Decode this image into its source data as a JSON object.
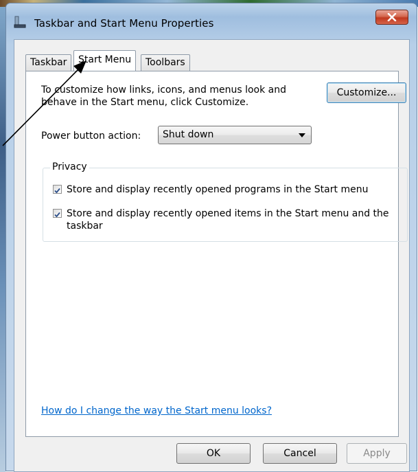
{
  "window": {
    "title": "Taskbar and Start Menu Properties"
  },
  "tabs": [
    {
      "label": "Taskbar",
      "active": false
    },
    {
      "label": "Start Menu",
      "active": true
    },
    {
      "label": "Toolbars",
      "active": false
    }
  ],
  "start_menu": {
    "description": "To customize how links, icons, and menus look and behave in the Start menu, click Customize.",
    "customize_label": "Customize...",
    "power_label": "Power button action:",
    "power_value": "Shut down",
    "privacy": {
      "label": "Privacy",
      "items": [
        {
          "label": "Store and display recently opened programs in the Start menu",
          "checked": true
        },
        {
          "label": "Store and display recently opened items in the Start menu and the taskbar",
          "checked": true
        }
      ]
    },
    "help_link": "How do I change the way the Start menu looks?"
  },
  "buttons": {
    "ok": "OK",
    "cancel": "Cancel",
    "apply": "Apply"
  },
  "icons": {
    "title": "taskbar-window-icon",
    "close": "close-icon",
    "check": "checkmark-icon",
    "dropdown": "chevron-down-icon"
  }
}
